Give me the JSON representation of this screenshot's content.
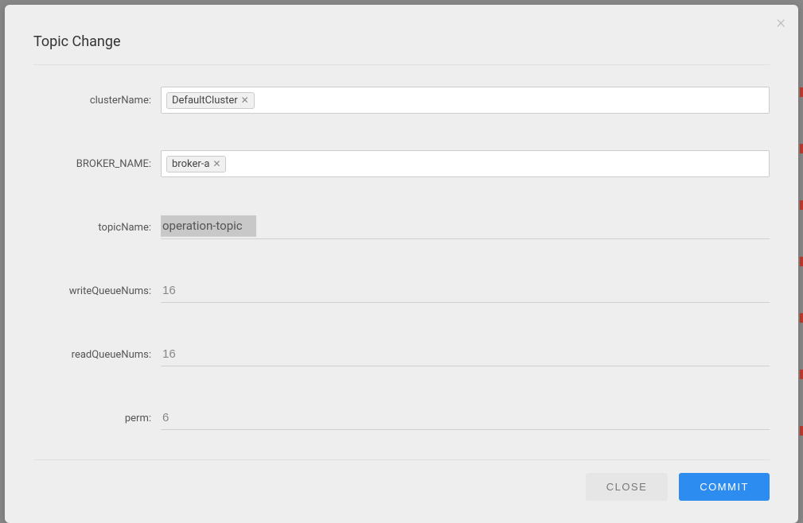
{
  "modal": {
    "title": "Topic Change",
    "fields": {
      "clusterName": {
        "label": "clusterName:",
        "tags": [
          "DefaultCluster"
        ]
      },
      "brokerName": {
        "label": "BROKER_NAME:",
        "tags": [
          "broker-a"
        ]
      },
      "topicName": {
        "label": "topicName:",
        "value": "operation-topic"
      },
      "writeQueueNums": {
        "label": "writeQueueNums:",
        "value": "16"
      },
      "readQueueNums": {
        "label": "readQueueNums:",
        "value": "16"
      },
      "perm": {
        "label": "perm:",
        "value": "6"
      }
    },
    "buttons": {
      "close": "CLOSE",
      "commit": "COMMIT"
    }
  }
}
